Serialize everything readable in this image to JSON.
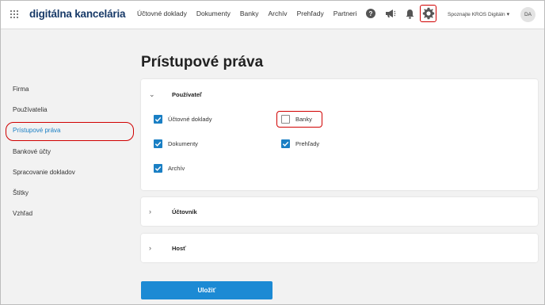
{
  "header": {
    "logo": "digitálna kancelária",
    "nav": [
      "Účtovné doklady",
      "Dokumenty",
      "Banky",
      "Archív",
      "Prehľady",
      "Partneri"
    ],
    "user_menu": "Spoznajte KROS Digitáln",
    "avatar_initials": "DA"
  },
  "sidebar": {
    "items": [
      "Firma",
      "Používatelia",
      "Prístupové práva",
      "Bankové účty",
      "Spracovanie dokladov",
      "Štítky",
      "Vzhľad"
    ],
    "active_index": 2
  },
  "main": {
    "title": "Prístupové práva",
    "sections": [
      {
        "title": "Používateľ",
        "expanded": true,
        "permissions": [
          {
            "label": "Účtovné doklady",
            "checked": true
          },
          {
            "label": "Banky",
            "checked": false
          },
          {
            "label": "Dokumenty",
            "checked": true
          },
          {
            "label": "Prehľady",
            "checked": true
          },
          {
            "label": "Archív",
            "checked": true
          }
        ]
      },
      {
        "title": "Účtovník",
        "expanded": false
      },
      {
        "title": "Hosť",
        "expanded": false
      }
    ],
    "save_label": "Uložiť"
  },
  "colors": {
    "accent": "#1a7fc4",
    "button": "#1c8ad4",
    "highlight": "#d00000",
    "logo": "#183a68"
  },
  "icons": [
    "apps-icon",
    "help-icon",
    "megaphone-icon",
    "bell-icon",
    "gear-icon",
    "chevron-down-icon",
    "chevron-right-icon",
    "checkmark-icon"
  ]
}
